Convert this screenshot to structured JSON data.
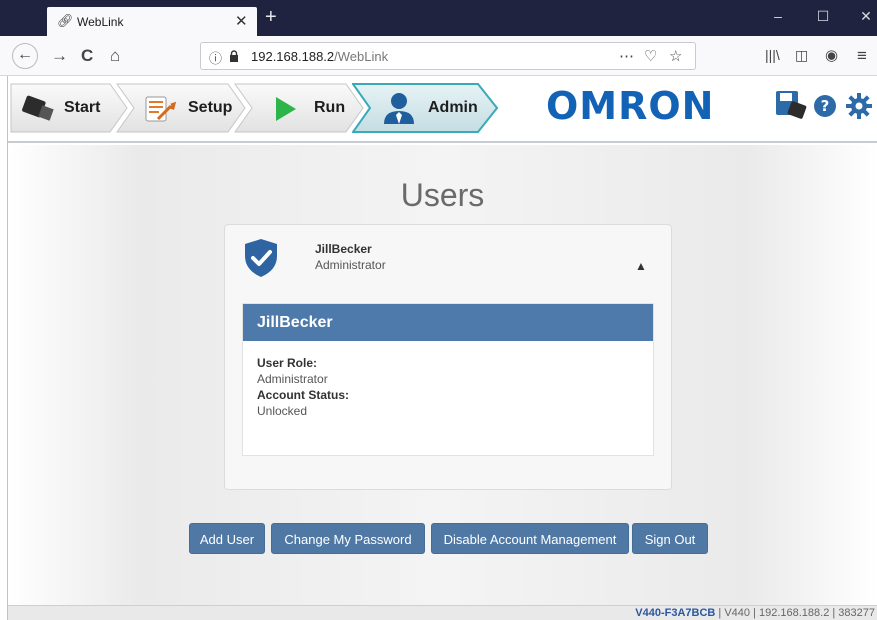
{
  "browser": {
    "tab_title": "WebLink",
    "url_host": "192.168.188.2",
    "url_path": "/WebLink",
    "more_icon": "⋯"
  },
  "header": {
    "steps": [
      {
        "label": "Start",
        "icon": "camera-icon"
      },
      {
        "label": "Setup",
        "icon": "wrench-icon"
      },
      {
        "label": "Run",
        "icon": "play-icon"
      },
      {
        "label": "Admin",
        "icon": "user-icon"
      }
    ],
    "logo": "OMRON",
    "active_step": "Admin"
  },
  "main": {
    "title": "Users",
    "user": {
      "name": "JillBecker",
      "role": "Administrator",
      "detail_title": "JillBecker",
      "user_role_label": "User Role:",
      "user_role_value": "Administrator",
      "account_status_label": "Account Status:",
      "account_status_value": "Unlocked"
    },
    "buttons": {
      "add_user": "Add User",
      "change_password": "Change My Password",
      "disable_account_mgmt": "Disable Account Management",
      "sign_out": "Sign Out"
    }
  },
  "status_bar": {
    "device_id": "V440-F3A7BCB",
    "rest": " | V440 | 192.168.188.2 | 383277"
  },
  "colors": {
    "accent": "#4d7aab",
    "button": "#4f78a4",
    "logo": "#1262b6",
    "chrome_dark": "#202340"
  }
}
